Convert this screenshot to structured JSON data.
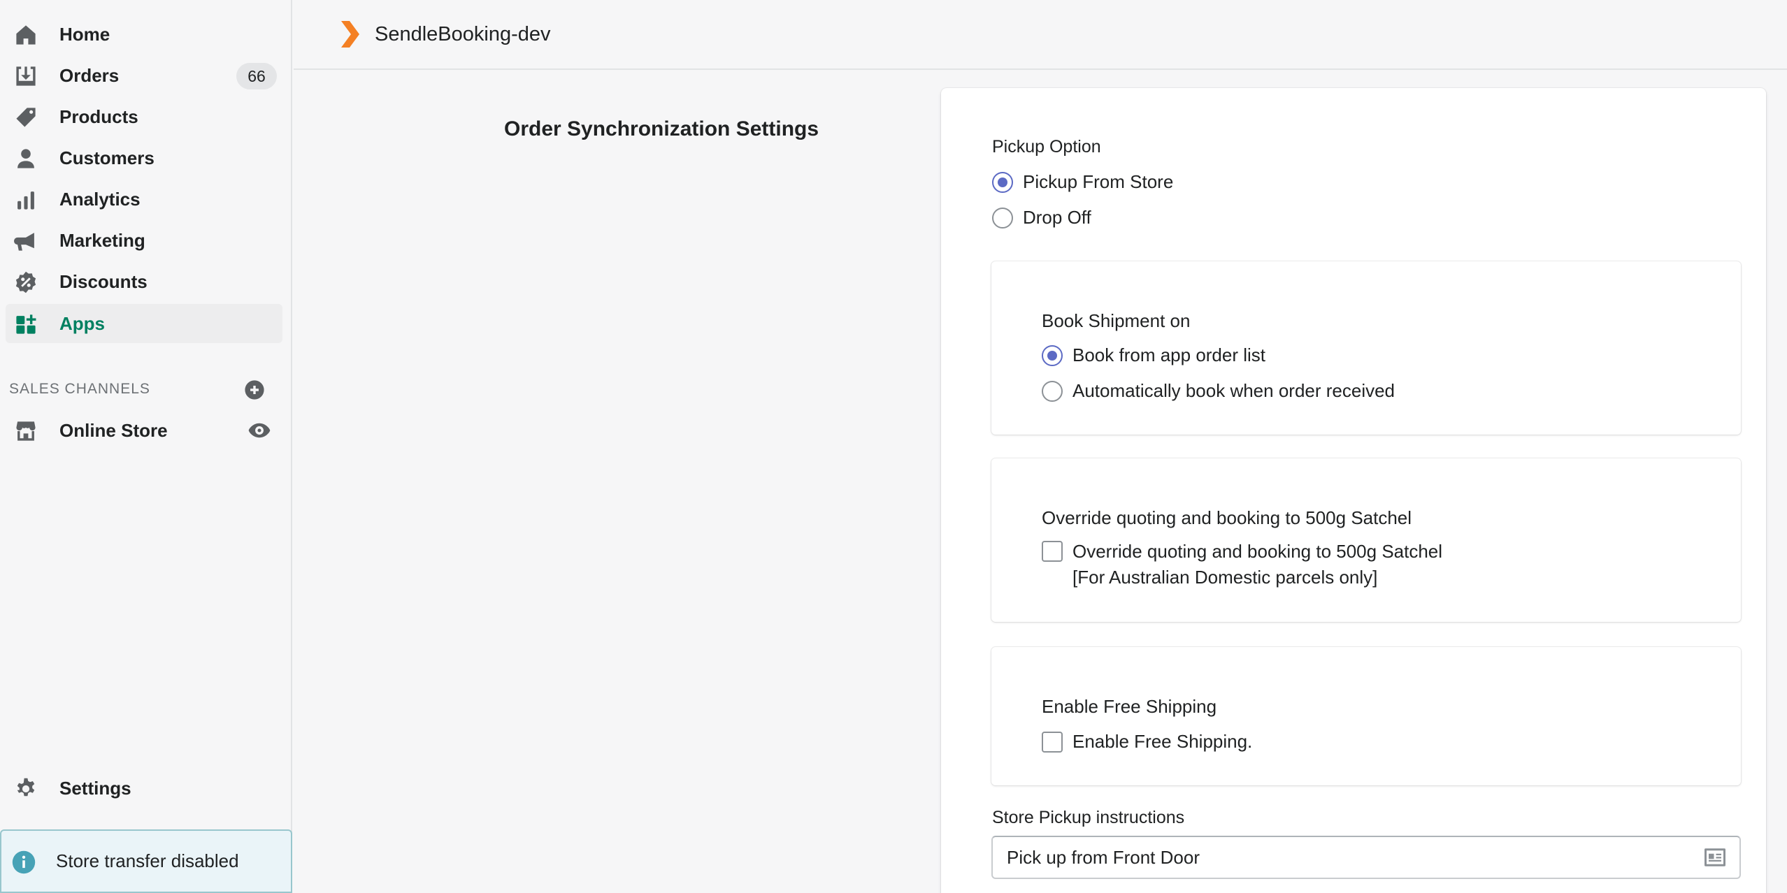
{
  "sidebar": {
    "items": [
      {
        "label": "Home",
        "icon": "home-icon"
      },
      {
        "label": "Orders",
        "icon": "orders-icon",
        "badge": "66"
      },
      {
        "label": "Products",
        "icon": "tag-icon"
      },
      {
        "label": "Customers",
        "icon": "person-icon"
      },
      {
        "label": "Analytics",
        "icon": "bar-chart-icon"
      },
      {
        "label": "Marketing",
        "icon": "megaphone-icon"
      },
      {
        "label": "Discounts",
        "icon": "discount-icon"
      },
      {
        "label": "Apps",
        "icon": "apps-icon",
        "active": true
      }
    ],
    "sales_channels_title": "SALES CHANNELS",
    "online_store_label": "Online Store",
    "settings_label": "Settings",
    "store_transfer_text": "Store transfer disabled"
  },
  "topbar": {
    "app_title": "SendleBooking-dev"
  },
  "main": {
    "section_heading": "Order Synchronization Settings",
    "pickup_option": {
      "label": "Pickup Option",
      "options": [
        "Pickup From Store",
        "Drop Off"
      ],
      "selected": "Pickup From Store"
    },
    "book_shipment": {
      "label": "Book Shipment on",
      "options": [
        "Book from app order list",
        "Automatically book when order received"
      ],
      "selected": "Book from app order list"
    },
    "override": {
      "label": "Override quoting and booking to 500g Satchel",
      "checkbox_label": "Override quoting and booking to 500g Satchel",
      "checkbox_sublabel": "[For Australian Domestic parcels only]",
      "checked": false
    },
    "free_shipping": {
      "label": "Enable Free Shipping",
      "checkbox_label": "Enable Free Shipping.",
      "checked": false
    },
    "store_pickup": {
      "label": "Store Pickup instructions",
      "value": "Pick up from Front Door"
    }
  },
  "colors": {
    "accent_green": "#008060",
    "radio_indigo": "#5c6ac4",
    "logo_orange": "#f48024",
    "info_teal": "#47a2b6"
  }
}
